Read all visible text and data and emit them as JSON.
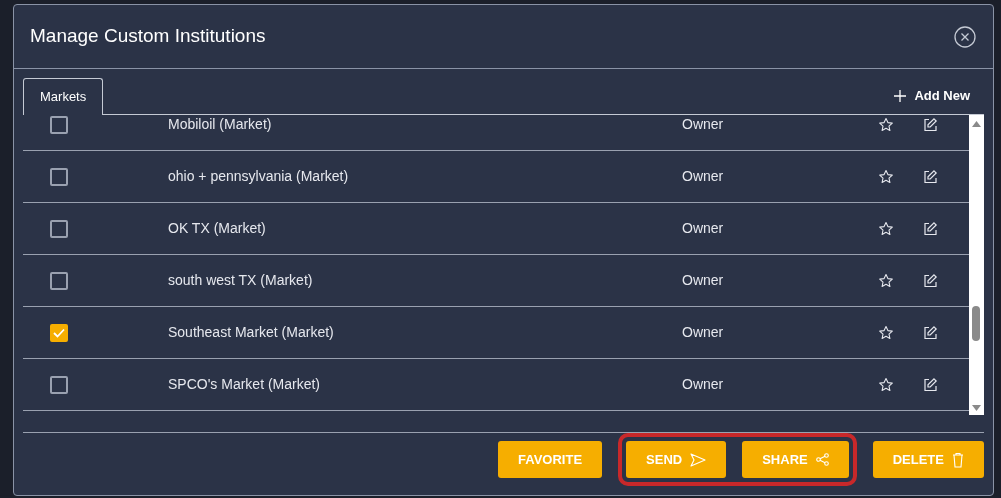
{
  "dialog": {
    "title": "Manage Custom Institutions"
  },
  "tabs": [
    {
      "label": "Markets",
      "selected": true
    }
  ],
  "add_new": {
    "label": "Add New"
  },
  "rows": [
    {
      "name": "Mobiloil (Market)",
      "role": "Owner",
      "checked": false
    },
    {
      "name": "ohio + pennsylvania (Market)",
      "role": "Owner",
      "checked": false
    },
    {
      "name": "OK TX (Market)",
      "role": "Owner",
      "checked": false
    },
    {
      "name": "south west TX (Market)",
      "role": "Owner",
      "checked": false
    },
    {
      "name": "Southeast Market (Market)",
      "role": "Owner",
      "checked": true
    },
    {
      "name": "SPCO's Market (Market)",
      "role": "Owner",
      "checked": false
    }
  ],
  "buttons": [
    {
      "label": "FAVORITE",
      "kind": "plain",
      "highlighted": false
    },
    {
      "label": "SEND",
      "kind": "send",
      "highlighted": true
    },
    {
      "label": "SHARE",
      "kind": "share",
      "highlighted": true
    },
    {
      "label": "DELETE",
      "kind": "delete",
      "highlighted": false
    }
  ]
}
